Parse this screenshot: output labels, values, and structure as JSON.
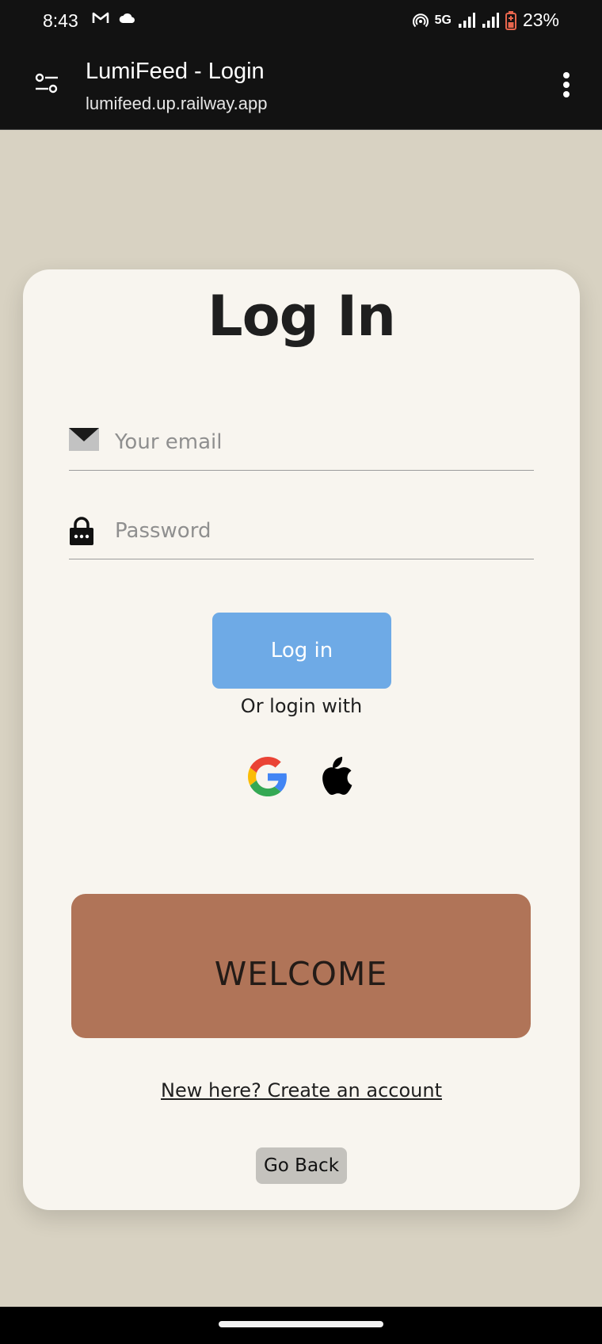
{
  "status_bar": {
    "time": "8:43",
    "network": "5G",
    "battery": "23%",
    "icons": [
      "gmail-icon",
      "cloud-icon",
      "hotspot-icon",
      "signal-icon",
      "battery-icon"
    ]
  },
  "browser": {
    "page_title": "LumiFeed - Login",
    "url": "lumifeed.up.railway.app"
  },
  "card": {
    "title": "Log In",
    "email_placeholder": "Your email",
    "email_value": "",
    "password_placeholder": "Password",
    "password_value": "",
    "login_button": "Log in",
    "or_label": "Or login with",
    "social_icons": [
      "google-icon",
      "apple-icon"
    ],
    "welcome": "WELCOME",
    "create_account_link": "New here? Create an account",
    "go_back_button": "Go Back"
  },
  "colors": {
    "page_background": "#d8d2c2",
    "card_background": "#f8f5ef",
    "login_button": "#6eaae6",
    "welcome_banner": "#b07458",
    "go_back_button": "#c4c2bd"
  }
}
